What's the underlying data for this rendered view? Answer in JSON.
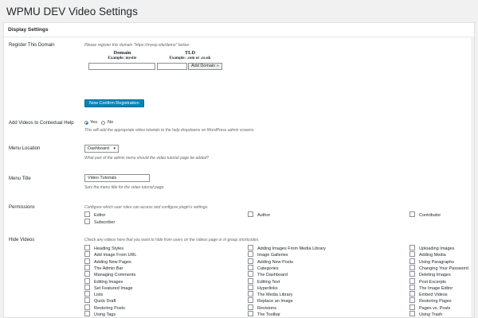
{
  "page": {
    "title": "WPMU DEV Video Settings"
  },
  "panel": {
    "header": "Display Settings"
  },
  "register_domain": {
    "label": "Register This Domain",
    "hint": "Please register this domain \"https://mywp.site/demo\" below:",
    "domain_heading": "Domain",
    "domain_example": "Example: mysite",
    "tld_heading": "TLD",
    "tld_example": "Example: .com or .co.uk",
    "domain_value": "",
    "tld_value": "",
    "add_button": "Add Domain »",
    "confirm_button": "Now Confirm Registration"
  },
  "contextual_help": {
    "label": "Add Videos to Contextual Help",
    "yes": "Yes",
    "no": "No",
    "selected": "Yes",
    "hint": "This will add the appropriate video tutorials to the help dropdowns on WordPress admin screens."
  },
  "menu_location": {
    "label": "Menu Location",
    "selected": "Dashboard",
    "hint": "What part of the admin menu should the video tutorial page be added?"
  },
  "menu_title": {
    "label": "Menu Title",
    "value": "Video Tutorials",
    "hint": "Sets the menu title for the video tutorial page."
  },
  "permissions": {
    "label": "Permissions",
    "hint": "Configure which user roles can access and configure plugin's settings.",
    "roles": [
      "Editor",
      "Author",
      "Contributor",
      "Subscriber"
    ]
  },
  "hide_videos": {
    "label": "Hide Videos",
    "hint": "Check any videos here that you want to hide from users on the videos page or in group shortcodes.",
    "col1": [
      "Heading Styles",
      "Add Image From URL",
      "Adding New Pages",
      "The Admin Bar",
      "Managing Comments",
      "Editing Images",
      "Set Featured Image",
      "Lists",
      "Quick Draft",
      "Restoring Posts",
      "Using Tags"
    ],
    "col2": [
      "Adding Images From Media Library",
      "Image Galleries",
      "Adding New Posts",
      "Categories",
      "The Dashboard",
      "Editing Text",
      "Hyperlinks",
      "The Media Library",
      "Replace an Image",
      "Revisions",
      "The Toolbar"
    ],
    "col3": [
      "Uploading Images",
      "Adding Media",
      "Using Paragraphs",
      "Changing Your Password",
      "Deleting Images",
      "Post Excerpts",
      "The Image Editor",
      "Embed Videos",
      "Restoring Pages",
      "Pages vs. Posts",
      "Using Trash"
    ]
  }
}
